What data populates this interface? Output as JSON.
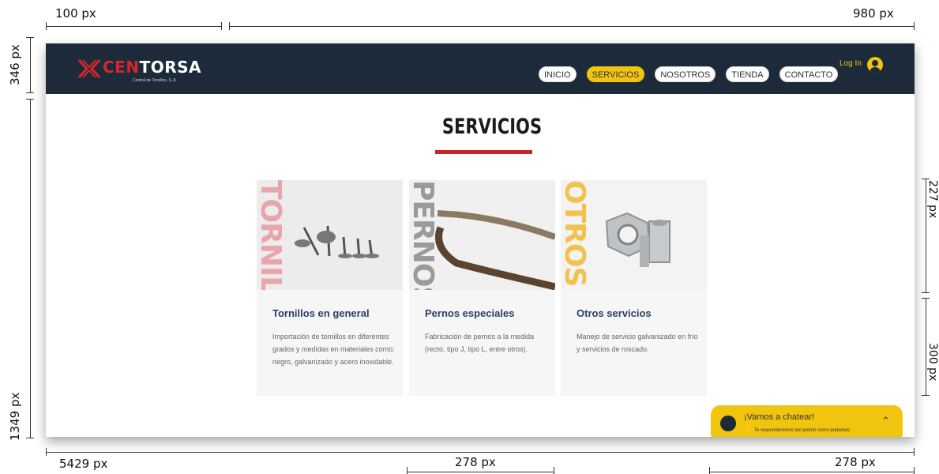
{
  "annotations": {
    "top_left": "100 px",
    "top_right": "980 px",
    "left_top": "346 px",
    "left_bottom": "1349 px",
    "right_top": "227 px",
    "right_bottom": "300 px",
    "bottom_left": "5429 px",
    "bottom_center": "278 px",
    "bottom_right": "278 px"
  },
  "header": {
    "logo_part1": "CEN",
    "logo_part2": "TORSA",
    "logo_sub": "Central de Tornillos, S. A",
    "nav": [
      {
        "label": "INICIO",
        "active": false
      },
      {
        "label": "SERVICIOS",
        "active": true
      },
      {
        "label": "NOSOTROS",
        "active": false
      },
      {
        "label": "TIENDA",
        "active": false
      },
      {
        "label": "CONTACTO",
        "active": false
      }
    ],
    "login": "Log In"
  },
  "main": {
    "title": "SERVICIOS",
    "cards": [
      {
        "word": "TORNILLOS",
        "word_color": "#e8a6ab",
        "title": "Tornillos en general",
        "desc": "Importación de tornillos en diferentes grados y medidas en materiales como: negro, galvanizado y acero inoxidable."
      },
      {
        "word": "PERNOS",
        "word_color": "#9a9a9a",
        "title": "Pernos especiales",
        "desc": "Fabricación de pernos a la medida (recto, tipo J, tipo L, entre otros)."
      },
      {
        "word": "OTROS",
        "word_color": "#f2c14e",
        "title": "Otros servicios",
        "desc": "Manejo de servicio galvanizado en frío y servicios de roscado."
      }
    ]
  },
  "chat": {
    "title": "¡Vamos a chatear!",
    "subtitle": "Te responderemos tan pronto como podamos"
  },
  "colors": {
    "header_bg": "#1c2a3a",
    "accent": "#f1c40f",
    "brand_red": "#d7262c"
  }
}
